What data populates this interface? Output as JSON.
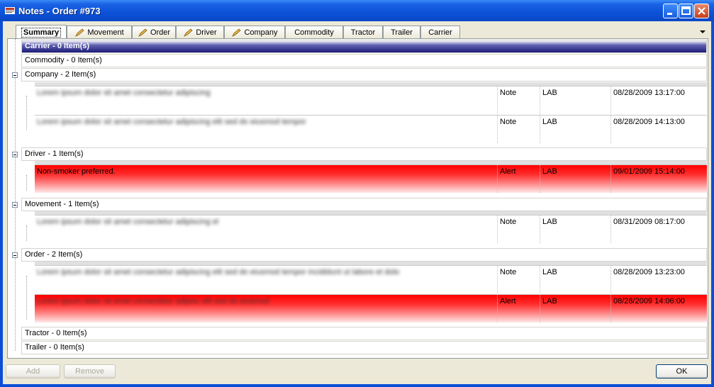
{
  "window": {
    "title": "Notes - Order #973"
  },
  "tabs": [
    {
      "label": "Summary",
      "icon": ""
    },
    {
      "label": "Movement",
      "icon": "pencil-icon"
    },
    {
      "label": "Order",
      "icon": "pencil-icon"
    },
    {
      "label": "Driver",
      "icon": "pencil-icon"
    },
    {
      "label": "Company",
      "icon": "pencil-icon"
    },
    {
      "label": "Commodity",
      "icon": ""
    },
    {
      "label": "Tractor",
      "icon": ""
    },
    {
      "label": "Trailer",
      "icon": ""
    },
    {
      "label": "Carrier",
      "icon": ""
    }
  ],
  "groups": {
    "carrier": "Carrier - 0 Item(s)",
    "commodity": "Commodity - 0 Item(s)",
    "company": "Company - 2 Item(s)",
    "driver": "Driver - 1 Item(s)",
    "movement": "Movement - 1 Item(s)",
    "order": "Order - 2 Item(s)",
    "tractor": "Tractor - 0 Item(s)",
    "trailer": "Trailer - 0 Item(s)"
  },
  "notes": {
    "company_1": {
      "text": "Lorem ipsum dolor sit amet consectetur adipiscing",
      "type": "Note",
      "user": "LAB",
      "date": "08/28/2009 13:17:00"
    },
    "company_2": {
      "text": "Lorem ipsum dolor sit amet consectetur adipiscing elit sed do eiusmod tempor",
      "type": "Note",
      "user": "LAB",
      "date": "08/28/2009 14:13:00"
    },
    "driver_1": {
      "text": "Non-smoker preferred.",
      "type": "Alert",
      "user": "LAB",
      "date": "09/01/2009 15:14:00"
    },
    "movement_1": {
      "text": "Lorem ipsum dolor sit amet consectetur adipiscing el",
      "type": "Note",
      "user": "LAB",
      "date": "08/31/2009 08:17:00"
    },
    "order_1": {
      "text": "Lorem ipsum dolor sit amet consectetur adipiscing elit sed do eiusmod tempor incididunt ut labore et dolo",
      "type": "Note",
      "user": "LAB",
      "date": "08/28/2009 13:23:00"
    },
    "order_2": {
      "text": "Lorem ipsum dolor sit amet consectetur adipisc elit sed do eiusmod",
      "type": "Alert",
      "user": "LAB",
      "date": "08/28/2009 14:06:00"
    }
  },
  "buttons": {
    "add": "Add",
    "remove": "Remove",
    "ok": "OK"
  },
  "colors": {
    "titlebar": "#0a48c6",
    "alert": "#ff0000",
    "selected_group": "#1c1c7a"
  }
}
